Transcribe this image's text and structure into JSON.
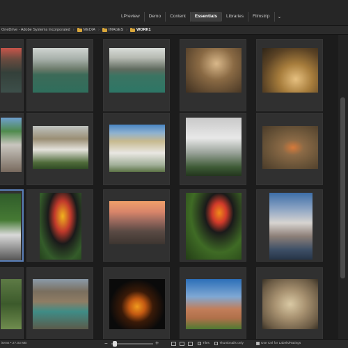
{
  "workspace_tabs": [
    {
      "label": "LPreview"
    },
    {
      "label": "Demo"
    },
    {
      "label": "Content"
    },
    {
      "label": "Essentials",
      "active": true
    },
    {
      "label": "Libraries"
    },
    {
      "label": "Filmstrip"
    }
  ],
  "workspace_more_icon": "chevron-down-icon",
  "breadcrumb": [
    {
      "label": "OneDrive - Adobe Systems Incorporated"
    },
    {
      "label": "MEDIA"
    },
    {
      "label": "IMAGES"
    },
    {
      "label": "WORK1",
      "active": true
    }
  ],
  "status": {
    "text": "items • 27.03 MB"
  },
  "bottom_controls": {
    "zoom_level": 0.08,
    "thumbnails_only_label": "Thumbnails only",
    "ctrl_label": "Use Ctrl for Labels/Ratings",
    "tiles_label": "Tiles"
  },
  "colors": {
    "accent": "#5a7fb8",
    "folder": "#d9a63a",
    "background": "#1c1c1c"
  }
}
